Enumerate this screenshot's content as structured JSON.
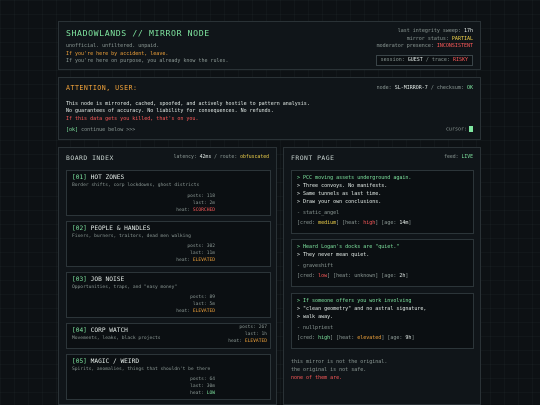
{
  "header": {
    "title": "SHADOWLANDS // MIRROR NODE",
    "line1": "unofficial. unfiltered. unpaid.",
    "line2": "If you're here by accident, leave.",
    "line3": "If you're here on purpose, you already know the rules.",
    "sweep_label": "last integrity sweep:",
    "sweep_value": "17h",
    "status_label": "mirror status:",
    "status_value": "PARTIAL",
    "mod_label": "moderator presence:",
    "mod_value": "INCONSISTENT",
    "session_label": "session:",
    "session_value": "GUEST",
    "trace_label": "/ trace:",
    "trace_value": "RISKY"
  },
  "attention": {
    "title": "ATTENTION, USER:",
    "node_label": "node:",
    "node_value": "SL-MIRROR-7",
    "checksum_label": "/ checksum:",
    "checksum_value": "OK",
    "line1": "This node is mirrored, cached, spoofed, and actively hostile to pattern analysis.",
    "line2": "No guarantees of accuracy. No liability for consequences. No refunds.",
    "line3": "If this data gets you killed, that's on you.",
    "continue_tag": "[ok]",
    "continue_text": "continue below >>>",
    "cursor_label": "cursor:"
  },
  "board": {
    "title": "BOARD INDEX",
    "latency_label": "latency:",
    "latency_value": "42ms",
    "route_label": "/ route:",
    "route_value": "obfuscated",
    "zones": [
      {
        "num": "[01]",
        "name": "HOT ZONES",
        "desc": "Border shifts, corp lockdowns, ghost districts",
        "posts": "posts: 118",
        "last": "last: 2m",
        "heat_label": "heat:",
        "heat": "SCORCHED"
      },
      {
        "num": "[02]",
        "name": "PEOPLE & HANDLES",
        "desc": "Fixers, burners, traitors, dead men walking",
        "posts": "posts: 302",
        "last": "last: 11m",
        "heat_label": "heat:",
        "heat": "ELEVATED"
      },
      {
        "num": "[03]",
        "name": "JOB NOISE",
        "desc": "Opportunities, traps, and \"easy money\"",
        "posts": "posts: 89",
        "last": "last: 5m",
        "heat_label": "heat:",
        "heat": "ELEVATED"
      },
      {
        "num": "[04]",
        "name": "CORP WATCH",
        "desc": "Movements, leaks, black projects",
        "posts": "posts: 267",
        "last": "last: 1h",
        "heat_label": "heat:",
        "heat": "ELEVATED"
      },
      {
        "num": "[05]",
        "name": "MAGIC / WEIRD",
        "desc": "Spirits, anomalies, things that shouldn't be there",
        "posts": "posts: 64",
        "last": "last: 30m",
        "heat_label": "heat:",
        "heat": "LOW"
      }
    ]
  },
  "front": {
    "title": "FRONT PAGE",
    "feed_label": "feed:",
    "feed_value": "LIVE",
    "posts": [
      {
        "lines": [
          "> PCC moving assets underground again.",
          "> Three convoys. No manifests.",
          "> Same tunnels as last time.",
          "> Draw your own conclusions."
        ],
        "sig": "- static_angel",
        "cred": "medium",
        "heat": "high",
        "age": "14m"
      },
      {
        "lines": [
          "> Heard Logan's docks are \"quiet.\"",
          "> They never mean quiet."
        ],
        "sig": "- graveshift",
        "cred": "low",
        "heat": "unknown",
        "age": "2h"
      },
      {
        "lines": [
          "> If someone offers you work involving",
          "> \"clean geometry\" and no astral signature,",
          "> walk away."
        ],
        "sig": "- nullpriest",
        "cred": "high",
        "heat": "elevated",
        "age": "9h"
      }
    ],
    "footer1": "this mirror is not the original.",
    "footer2": "the original is not safe.",
    "footer3": "none of them are."
  },
  "colors": {
    "accent": "#7fe6a0",
    "warn": "#f0d24a",
    "danger": "#ff5a5a",
    "attention": "#f0a23a"
  }
}
